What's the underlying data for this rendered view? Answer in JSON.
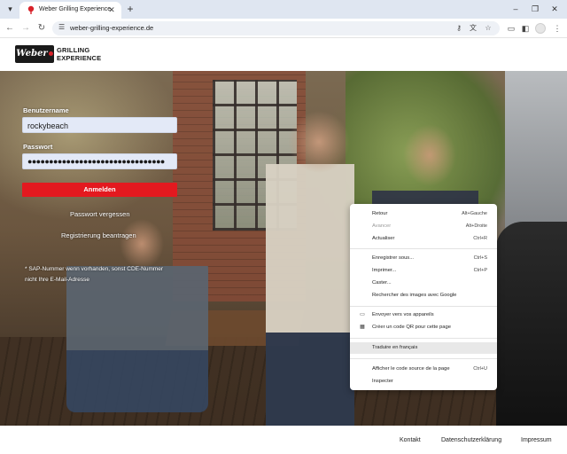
{
  "browser": {
    "tab_title": "Weber Grilling Experience",
    "url": "weber-grilling-experience.de",
    "icons": {
      "tab_search": "chevron-down-icon",
      "tab_close": "close-icon",
      "new_tab": "plus-icon",
      "back": "back-arrow-icon",
      "forward": "forward-arrow-icon",
      "reload": "reload-icon",
      "site_info": "site-info-icon",
      "password_key": "key-icon",
      "translate": "translate-icon",
      "bookmark": "star-icon",
      "cast": "cast-icon",
      "side_panel": "side-panel-icon",
      "menu": "kebab-menu-icon"
    }
  },
  "site": {
    "logo_badge": "Weber",
    "logo_line1": "GRILLING",
    "logo_line2": "EXPERIENCE"
  },
  "login": {
    "username_label": "Benutzername",
    "username_value": "rockybeach",
    "password_label": "Passwort",
    "password_mask": "●●●●●●●●●●●●●●●●●●●●●●●●●●●●●●●●",
    "submit_label": "Anmelden",
    "forgot_link": "Passwort vergessen",
    "register_link": "Registrierung beantragen",
    "note_line1": "* SAP-Nummer wenn vorhanden, sonst CDE-Nummer",
    "note_line2": "nicht Ihre E-Mail-Adresse"
  },
  "context_menu": {
    "items": [
      {
        "label": "Retour",
        "shortcut": "Alt+Gauche"
      },
      {
        "label": "Avancer",
        "shortcut": "Alt+Droite"
      },
      {
        "label": "Actualiser",
        "shortcut": "Ctrl+R"
      },
      {
        "label": "Enregistrer sous...",
        "shortcut": "Ctrl+S"
      },
      {
        "label": "Imprimer...",
        "shortcut": "Ctrl+P"
      },
      {
        "label": "Caster...",
        "shortcut": ""
      },
      {
        "label": "Rechercher des images avec Google",
        "shortcut": ""
      },
      {
        "label": "Envoyer vers vos appareils",
        "shortcut": ""
      },
      {
        "label": "Créer un code QR pour cette page",
        "shortcut": ""
      },
      {
        "label": "Traduire en français",
        "shortcut": ""
      },
      {
        "label": "Afficher le code source de la page",
        "shortcut": "Ctrl+U"
      },
      {
        "label": "Inspecter",
        "shortcut": ""
      }
    ]
  },
  "footer": {
    "contact": "Kontakt",
    "privacy": "Datenschutzerklärung",
    "imprint": "Impressum"
  },
  "colors": {
    "accent_red": "#e3191f",
    "chrome_bg": "#dfe6f1"
  }
}
